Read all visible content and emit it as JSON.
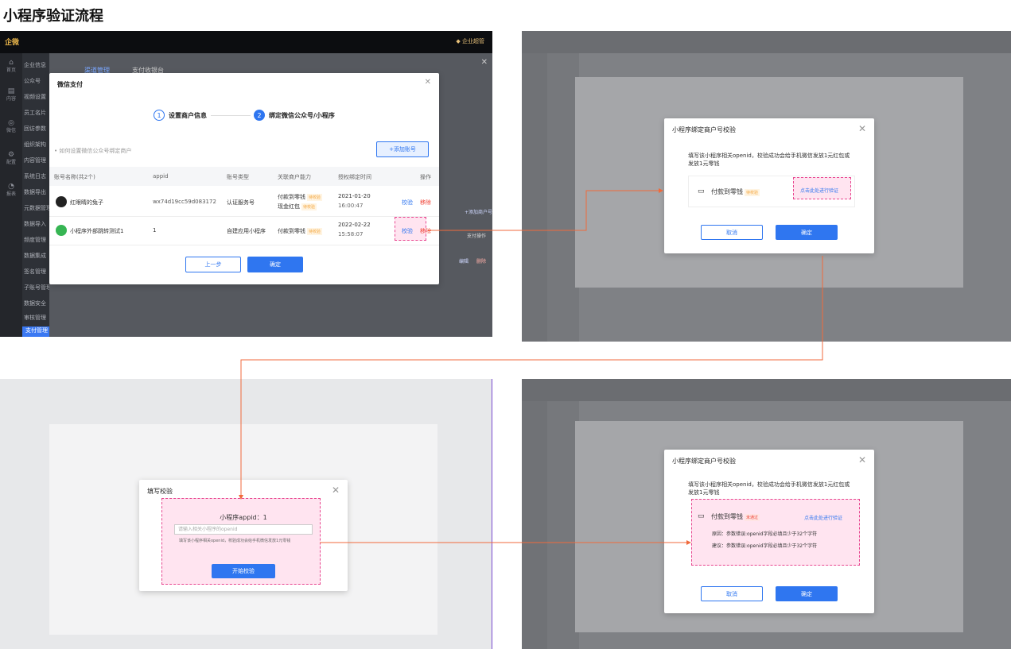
{
  "page_title": "小程序验证流程",
  "app": {
    "logo": "企微",
    "corp": "企业超管"
  },
  "sidebar": [
    {
      "icon": "home-icon",
      "label": "首页"
    },
    {
      "icon": "content-icon",
      "label": "内容"
    },
    {
      "icon": "wechat-icon",
      "label": "微信"
    },
    {
      "icon": "gear-icon",
      "label": "配置"
    },
    {
      "icon": "chart-icon",
      "label": "报表"
    }
  ],
  "menu_items": [
    "企业信息",
    "公众号",
    "视频设置",
    "员工名片",
    "回访参数",
    "组织架构",
    "内容管理",
    "系统日志",
    "数据导出",
    "元数据管理",
    "数据导入",
    "频度管理",
    "数据集成",
    "签名管理",
    "子账号管理",
    "数据安全",
    "审核管理",
    "支付管理"
  ],
  "bg_tabs": {
    "tab1": "渠道管理",
    "tab2": "支付收银台"
  },
  "bg_right": {
    "add": "+添加商户号",
    "op": "支付操作",
    "edit": "编辑",
    "del": "删除"
  },
  "wechat_modal": {
    "title": "微信支付",
    "step1": "设置商户信息",
    "step2": "绑定微信公众号/小程序",
    "step1_num": "1",
    "step2_num": "2",
    "hint": "• 如何设置微信公众号绑定商户",
    "add_btn": "+添加账号",
    "headers": [
      "账号名称(共2个)",
      "appid",
      "账号类型",
      "关联商户能力",
      "授权绑定时间",
      "操作"
    ],
    "rows": [
      {
        "name": "红眼睛的兔子",
        "appid": "wx74d19cc59d083172",
        "type": "认证服务号",
        "cap1": "付款到零钱",
        "cap1_tag": "待校验",
        "cap2": "现金红包",
        "cap2_tag": "待校验",
        "date": "2021-01-20",
        "time": "16:00:47",
        "op1": "校验",
        "op2": "移除"
      },
      {
        "name": "小程序外部跳转测试1",
        "appid": "1",
        "type": "自建应用小程序",
        "cap1": "付款到零钱",
        "cap1_tag": "待校验",
        "cap2": "",
        "cap2_tag": "",
        "date": "2022-02-22",
        "time": "15:58:07",
        "op1": "校验",
        "op2": "移除"
      }
    ],
    "prev": "上一步",
    "ok": "确定"
  },
  "verify_modal": {
    "title": "小程序绑定商户号校验",
    "desc": "填写该小程序相关openid，校验成功会给手机微信发放1元红包或发放1元零钱",
    "item": "付款到零钱",
    "tag": "待校验",
    "link": "点击此处进行验证",
    "cancel": "取消",
    "ok": "确定"
  },
  "fill_modal": {
    "title": "填写校验",
    "appid_label": "小程序appid：1",
    "placeholder": "请输入相关小程序的openid",
    "note": "填写该小程序相关openid，校验成功会给手机微信发放1元零钱",
    "start": "开始校验"
  },
  "result_modal": {
    "title": "小程序绑定商户号校验",
    "desc": "填写该小程序相关openid，校验成功会给手机微信发放1元红包或发放1元零钱",
    "item": "付款到零钱",
    "tag": "未通过",
    "link": "点击此处进行验证",
    "reason": "原因：参数错误:openid字段必填且少于32个字符",
    "suggest": "建议：参数错误:openid字段必填且少于32个字符",
    "cancel": "取消",
    "ok": "确定"
  },
  "colors": {
    "primary": "#2f76f0",
    "danger": "#f04134",
    "warn": "#f4a53c",
    "highlight": "#e8458f",
    "arrow": "#f06a3c"
  }
}
